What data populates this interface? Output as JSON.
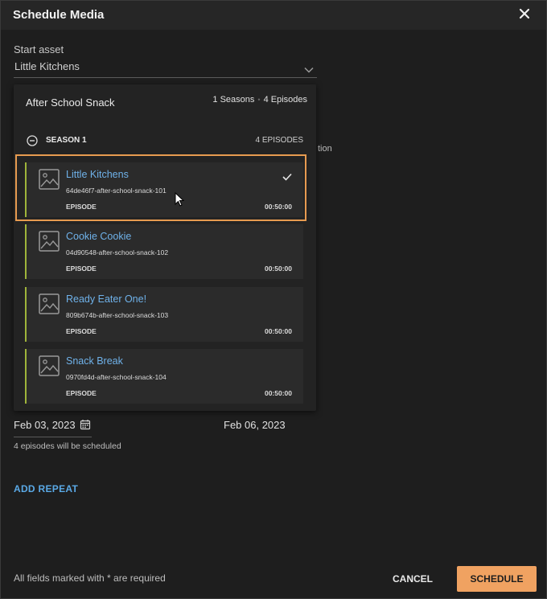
{
  "dialog": {
    "title": "Schedule Media"
  },
  "start_asset": {
    "label": "Start asset",
    "value": "Little Kitchens"
  },
  "obscured_text": "tion",
  "series": {
    "title": "After School Snack",
    "seasons_count": "1 Seasons",
    "episodes_count": "4 Episodes",
    "season": {
      "label": "SEASON 1",
      "count": "4 EPISODES",
      "episodes": [
        {
          "name": "Little Kitchens",
          "id": "64de46f7-after-school-snack-101",
          "type": "EPISODE",
          "duration": "00:50:00",
          "selected": true
        },
        {
          "name": "Cookie Cookie",
          "id": "04d90548-after-school-snack-102",
          "type": "EPISODE",
          "duration": "00:50:00",
          "selected": false
        },
        {
          "name": "Ready Eater One!",
          "id": "809b674b-after-school-snack-103",
          "type": "EPISODE",
          "duration": "00:50:00",
          "selected": false
        },
        {
          "name": "Snack Break",
          "id": "0970fd4d-after-school-snack-104",
          "type": "EPISODE",
          "duration": "00:50:00",
          "selected": false
        }
      ]
    }
  },
  "dates": {
    "start": "Feb 03, 2023",
    "end": "Feb 06, 2023",
    "note": "4 episodes will be scheduled"
  },
  "actions": {
    "add_repeat": "ADD REPEAT",
    "cancel": "CANCEL",
    "schedule": "SCHEDULE"
  },
  "footer": {
    "required_note": "All fields marked with * are required"
  },
  "colors": {
    "accent": "#f0a261",
    "link": "#6fb2ea",
    "episode_bar": "#9fb43a",
    "highlight": "#e79b50"
  }
}
